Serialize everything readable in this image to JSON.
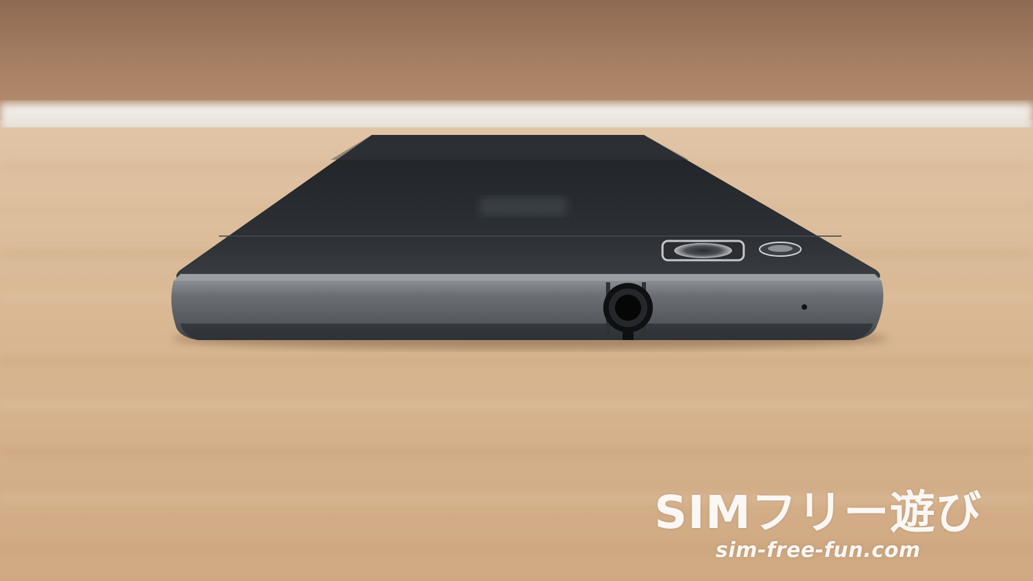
{
  "watermark": {
    "title": "SIMフリー遊び",
    "url": "sim-free-fun.com"
  },
  "colors": {
    "wall": "#a27a5f",
    "table": "#d8b693",
    "phone_back": "#2a2d31",
    "phone_frame": "#5d6165"
  }
}
